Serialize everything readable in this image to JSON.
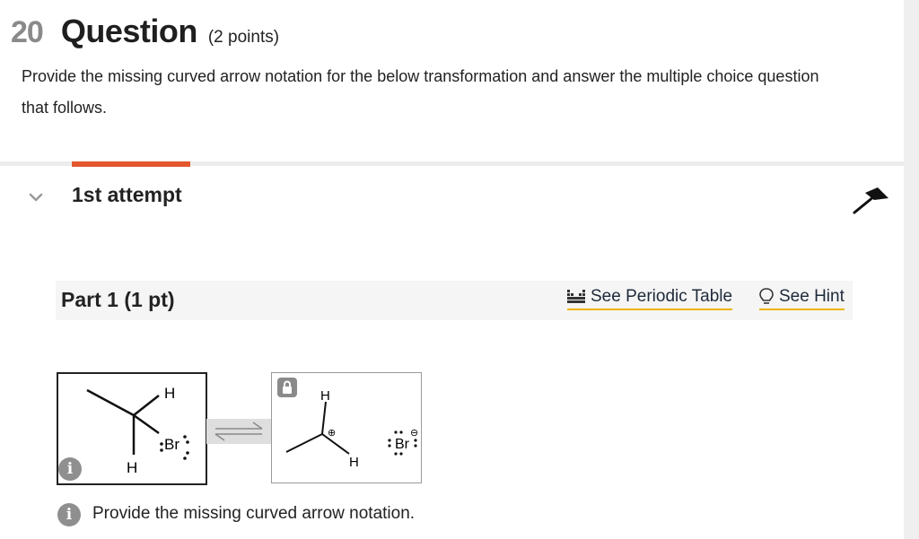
{
  "question": {
    "number": "20",
    "title": "Question",
    "points": "(2 points)",
    "prompt": "Provide the missing curved arrow notation for the below transformation and answer the multiple choice question that follows."
  },
  "attempt": {
    "label": "1st attempt"
  },
  "part": {
    "title": "Part 1 (1 pt)",
    "periodic_table_label": "See Periodic Table",
    "hint_label": "See Hint"
  },
  "molecule1": {
    "atoms": [
      "H",
      "Br",
      "H"
    ]
  },
  "molecule2": {
    "atoms": [
      "H",
      "H",
      "Br",
      "⊕",
      "⊖"
    ]
  },
  "instruction": "Provide the missing curved arrow notation.",
  "colors": {
    "accent": "#e4572e",
    "link_underline": "#f0b400",
    "icon_gray": "#8f8f8f"
  },
  "icons": [
    "chevron-down-icon",
    "flag-icon",
    "periodic-table-icon",
    "lightbulb-icon",
    "lock-icon",
    "info-icon"
  ]
}
